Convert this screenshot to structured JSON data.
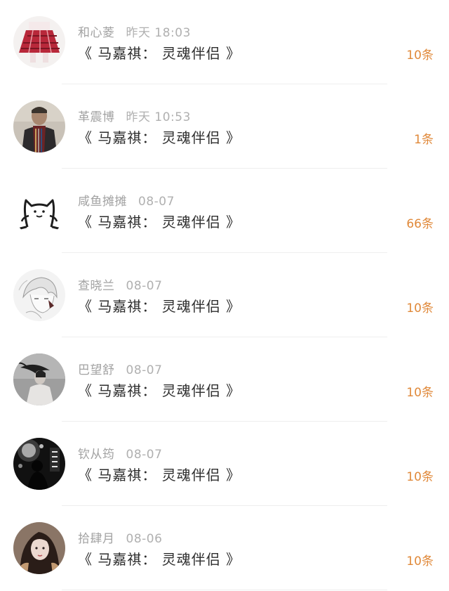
{
  "rows": [
    {
      "user": "和心菱",
      "time": "昨天 18:03",
      "title": "《 马嘉祺： 灵魂伴侣 》",
      "count": "10条",
      "avatar": "avatar-plaid-skirt"
    },
    {
      "user": "革震博",
      "time": "昨天 10:53",
      "title": "《 马嘉祺： 灵魂伴侣 》",
      "count": "1条",
      "avatar": "avatar-man-scarf"
    },
    {
      "user": "咸鱼摊摊",
      "time": "08-07",
      "title": "《 马嘉祺： 灵魂伴侣 》",
      "count": "66条",
      "avatar": "avatar-cat-doodle"
    },
    {
      "user": "查晓兰",
      "time": "08-07",
      "title": "《 马嘉祺： 灵魂伴侣 》",
      "count": "10条",
      "avatar": "avatar-anime-sketch"
    },
    {
      "user": "巴望舒",
      "time": "08-07",
      "title": "《 马嘉祺： 灵魂伴侣 》",
      "count": "10条",
      "avatar": "avatar-windblown-girl"
    },
    {
      "user": "钦从筠",
      "time": "08-07",
      "title": "《 马嘉祺： 灵魂伴侣 》",
      "count": "10条",
      "avatar": "avatar-silhouette-lights"
    },
    {
      "user": "拾肆月",
      "time": "08-06",
      "title": "《 马嘉祺： 灵魂伴侣 》",
      "count": "10条",
      "avatar": "avatar-girl-portrait"
    }
  ],
  "colors": {
    "count": "#e0893a",
    "meta": "#a2a2a2",
    "title": "#2d2d2d"
  }
}
